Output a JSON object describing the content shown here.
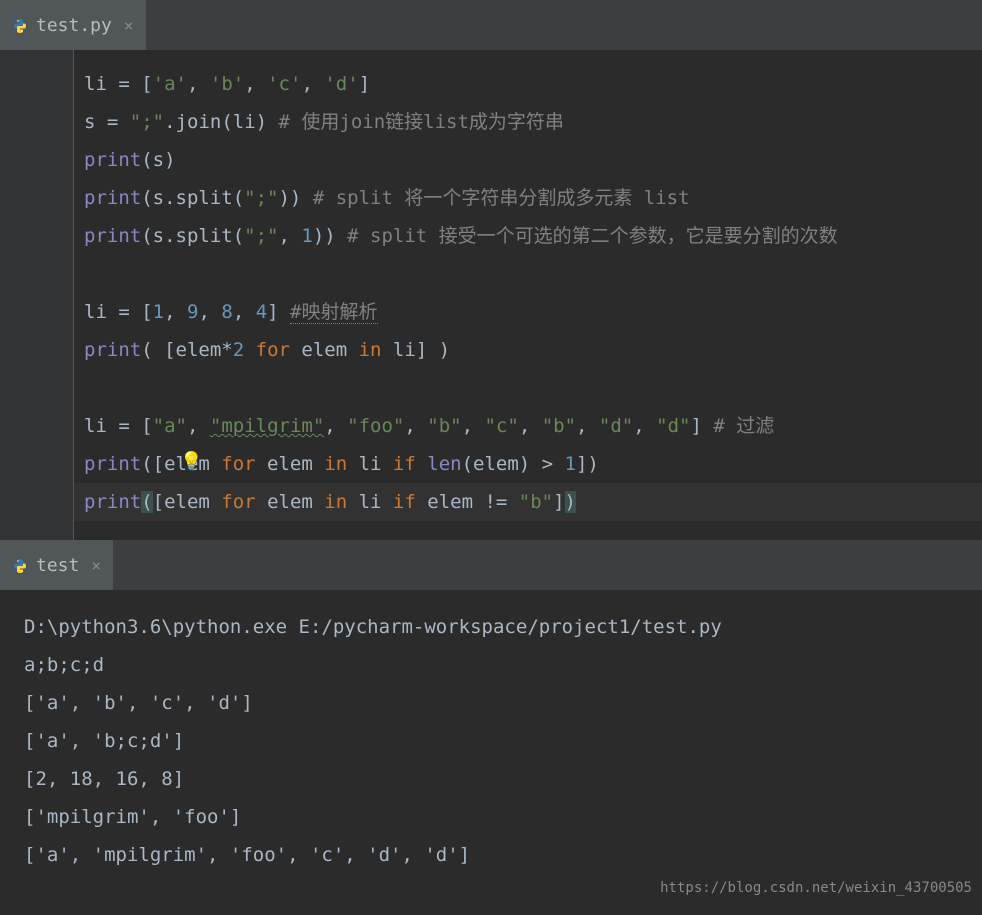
{
  "editor_tab": {
    "filename": "test.py",
    "close": "×"
  },
  "code": {
    "l1": {
      "a": "li ",
      "b": "=",
      "c": " [",
      "s1": "'a'",
      "p1": ", ",
      "s2": "'b'",
      "p2": ", ",
      "s3": "'c'",
      "p3": ", ",
      "s4": "'d'",
      "e": "]"
    },
    "l2": {
      "a": "s ",
      "b": "=",
      "c": " ",
      "s1": "\";\"",
      "d": ".join(li) ",
      "cm": "# 使用join链接list成为字符串"
    },
    "l3": {
      "fn": "print",
      "a": "(s)"
    },
    "l4": {
      "fn": "print",
      "a": "(s.split(",
      "s1": "\";\"",
      "b": ")) ",
      "cm": "# split 将一个字符串分割成多元素 list"
    },
    "l5": {
      "fn": "print",
      "a": "(s.split(",
      "s1": "\";\"",
      "b": ", ",
      "n1": "1",
      "c": ")) ",
      "cm": "# split 接受一个可选的第二个参数，它是要分割的次数"
    },
    "l7": {
      "a": "li ",
      "b": "=",
      "c": " [",
      "n1": "1",
      "p1": ", ",
      "n2": "9",
      "p2": ", ",
      "n3": "8",
      "p3": ", ",
      "n4": "4",
      "d": "] ",
      "cm": "#映射解析"
    },
    "l8": {
      "fn": "print",
      "a": "( [elem*",
      "n1": "2",
      "sp": " ",
      "k1": "for",
      "b": " elem ",
      "k2": "in",
      "c": " li] )"
    },
    "l10": {
      "a": "li ",
      "b": "=",
      "c": " [",
      "s1": "\"a\"",
      "p1": ", ",
      "s2": "\"mpilgrim\"",
      "p2": ", ",
      "s3": "\"foo\"",
      "p3": ", ",
      "s4": "\"b\"",
      "p4": ", ",
      "s5": "\"c\"",
      "p5": ", ",
      "s6": "\"b\"",
      "p6": ", ",
      "s7": "\"d\"",
      "p7": ", ",
      "s8": "\"d\"",
      "d": "] ",
      "cm": "# 过滤"
    },
    "l11": {
      "fn": "print",
      "a": "([elem ",
      "k1": "for",
      "b": " elem ",
      "k2": "in",
      "c": " li ",
      "k3": "if",
      "d": " ",
      "bi": "len",
      "e": "(elem) > ",
      "n1": "1",
      "f": "])"
    },
    "l12": {
      "fn": "print",
      "lp": "(",
      "a": "[elem ",
      "k1": "for",
      "b": " elem ",
      "k2": "in",
      "c": " li ",
      "k3": "if",
      "d": " elem != ",
      "s1": "\"b\"",
      "e": "]",
      "rp": ")"
    }
  },
  "terminal_tab": {
    "name": "test",
    "close": "×"
  },
  "terminal": {
    "l1": "D:\\python3.6\\python.exe E:/pycharm-workspace/project1/test.py",
    "l2": "a;b;c;d",
    "l3": "['a', 'b', 'c', 'd']",
    "l4": "['a', 'b;c;d']",
    "l5": "[2, 18, 16, 8]",
    "l6": "['mpilgrim', 'foo']",
    "l7": "['a', 'mpilgrim', 'foo', 'c', 'd', 'd']"
  },
  "watermark": "https://blog.csdn.net/weixin_43700505"
}
